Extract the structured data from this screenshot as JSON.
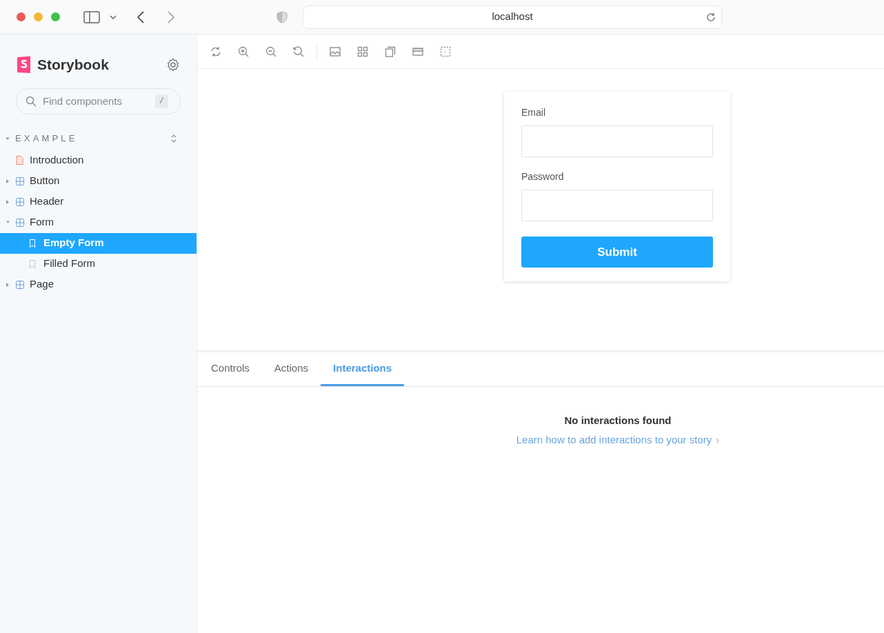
{
  "browser": {
    "url": "localhost"
  },
  "sidebar": {
    "brand": "Storybook",
    "search": {
      "placeholder": "Find components",
      "shortcut": "/"
    },
    "group": {
      "label": "EXAMPLE",
      "expanded": true,
      "items": [
        {
          "kind": "docs",
          "label": "Introduction",
          "selected": false
        },
        {
          "kind": "component",
          "label": "Button",
          "expanded": false,
          "selected": false
        },
        {
          "kind": "component",
          "label": "Header",
          "expanded": false,
          "selected": false
        },
        {
          "kind": "component",
          "label": "Form",
          "expanded": true,
          "selected": false,
          "children": [
            {
              "kind": "story",
              "label": "Empty Form",
              "selected": true
            },
            {
              "kind": "story",
              "label": "Filled Form",
              "selected": false
            }
          ]
        },
        {
          "kind": "component",
          "label": "Page",
          "expanded": false,
          "selected": false
        }
      ]
    }
  },
  "form": {
    "fields": [
      {
        "label": "Email"
      },
      {
        "label": "Password"
      }
    ],
    "button": "Submit"
  },
  "addons": {
    "tabs": [
      {
        "label": "Controls",
        "selected": false
      },
      {
        "label": "Actions",
        "selected": false
      },
      {
        "label": "Interactions",
        "selected": true
      }
    ],
    "empty": {
      "title": "No interactions found",
      "link": "Learn how to add interactions to your story",
      "link_icon": "›"
    }
  }
}
